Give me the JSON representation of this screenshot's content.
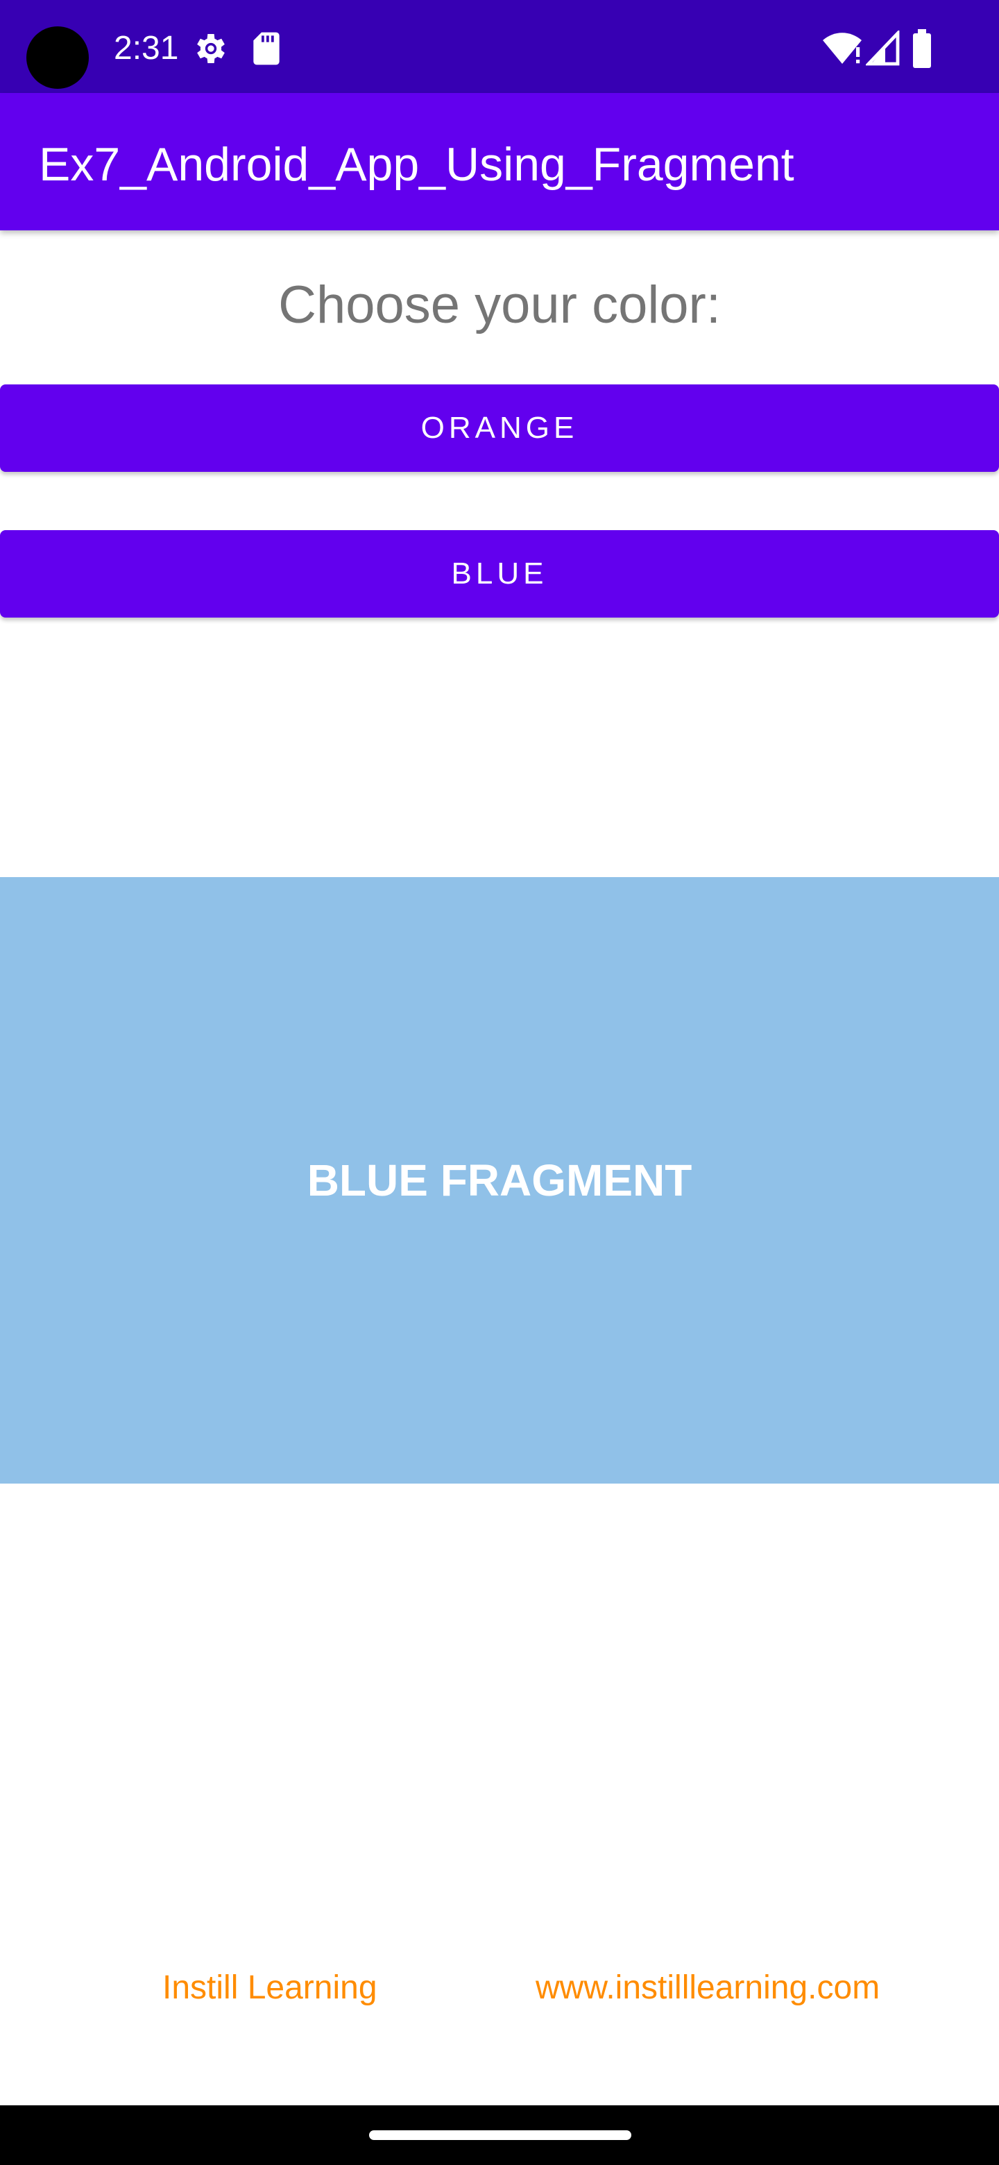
{
  "status_bar": {
    "time": "2:31",
    "icons": [
      "camera-cutout",
      "gear-icon",
      "sd-card-icon",
      "wifi-icon",
      "signal-icon",
      "battery-icon"
    ]
  },
  "app_bar": {
    "title": "Ex7_Android_App_Using_Fragment",
    "color": "#6200ee"
  },
  "main": {
    "prompt": "Choose your color:",
    "buttons": [
      {
        "label": "ORANGE"
      },
      {
        "label": "BLUE"
      }
    ],
    "fragment": {
      "label": "BLUE FRAGMENT",
      "background": "#90c1e8"
    }
  },
  "footer": {
    "left_text": "Instill Learning",
    "right_text": "www.instilllearning.com",
    "color": "#ff8c00"
  },
  "colors": {
    "status_bar": "#3700b3",
    "primary": "#6200ee",
    "prompt_text": "#757575"
  }
}
